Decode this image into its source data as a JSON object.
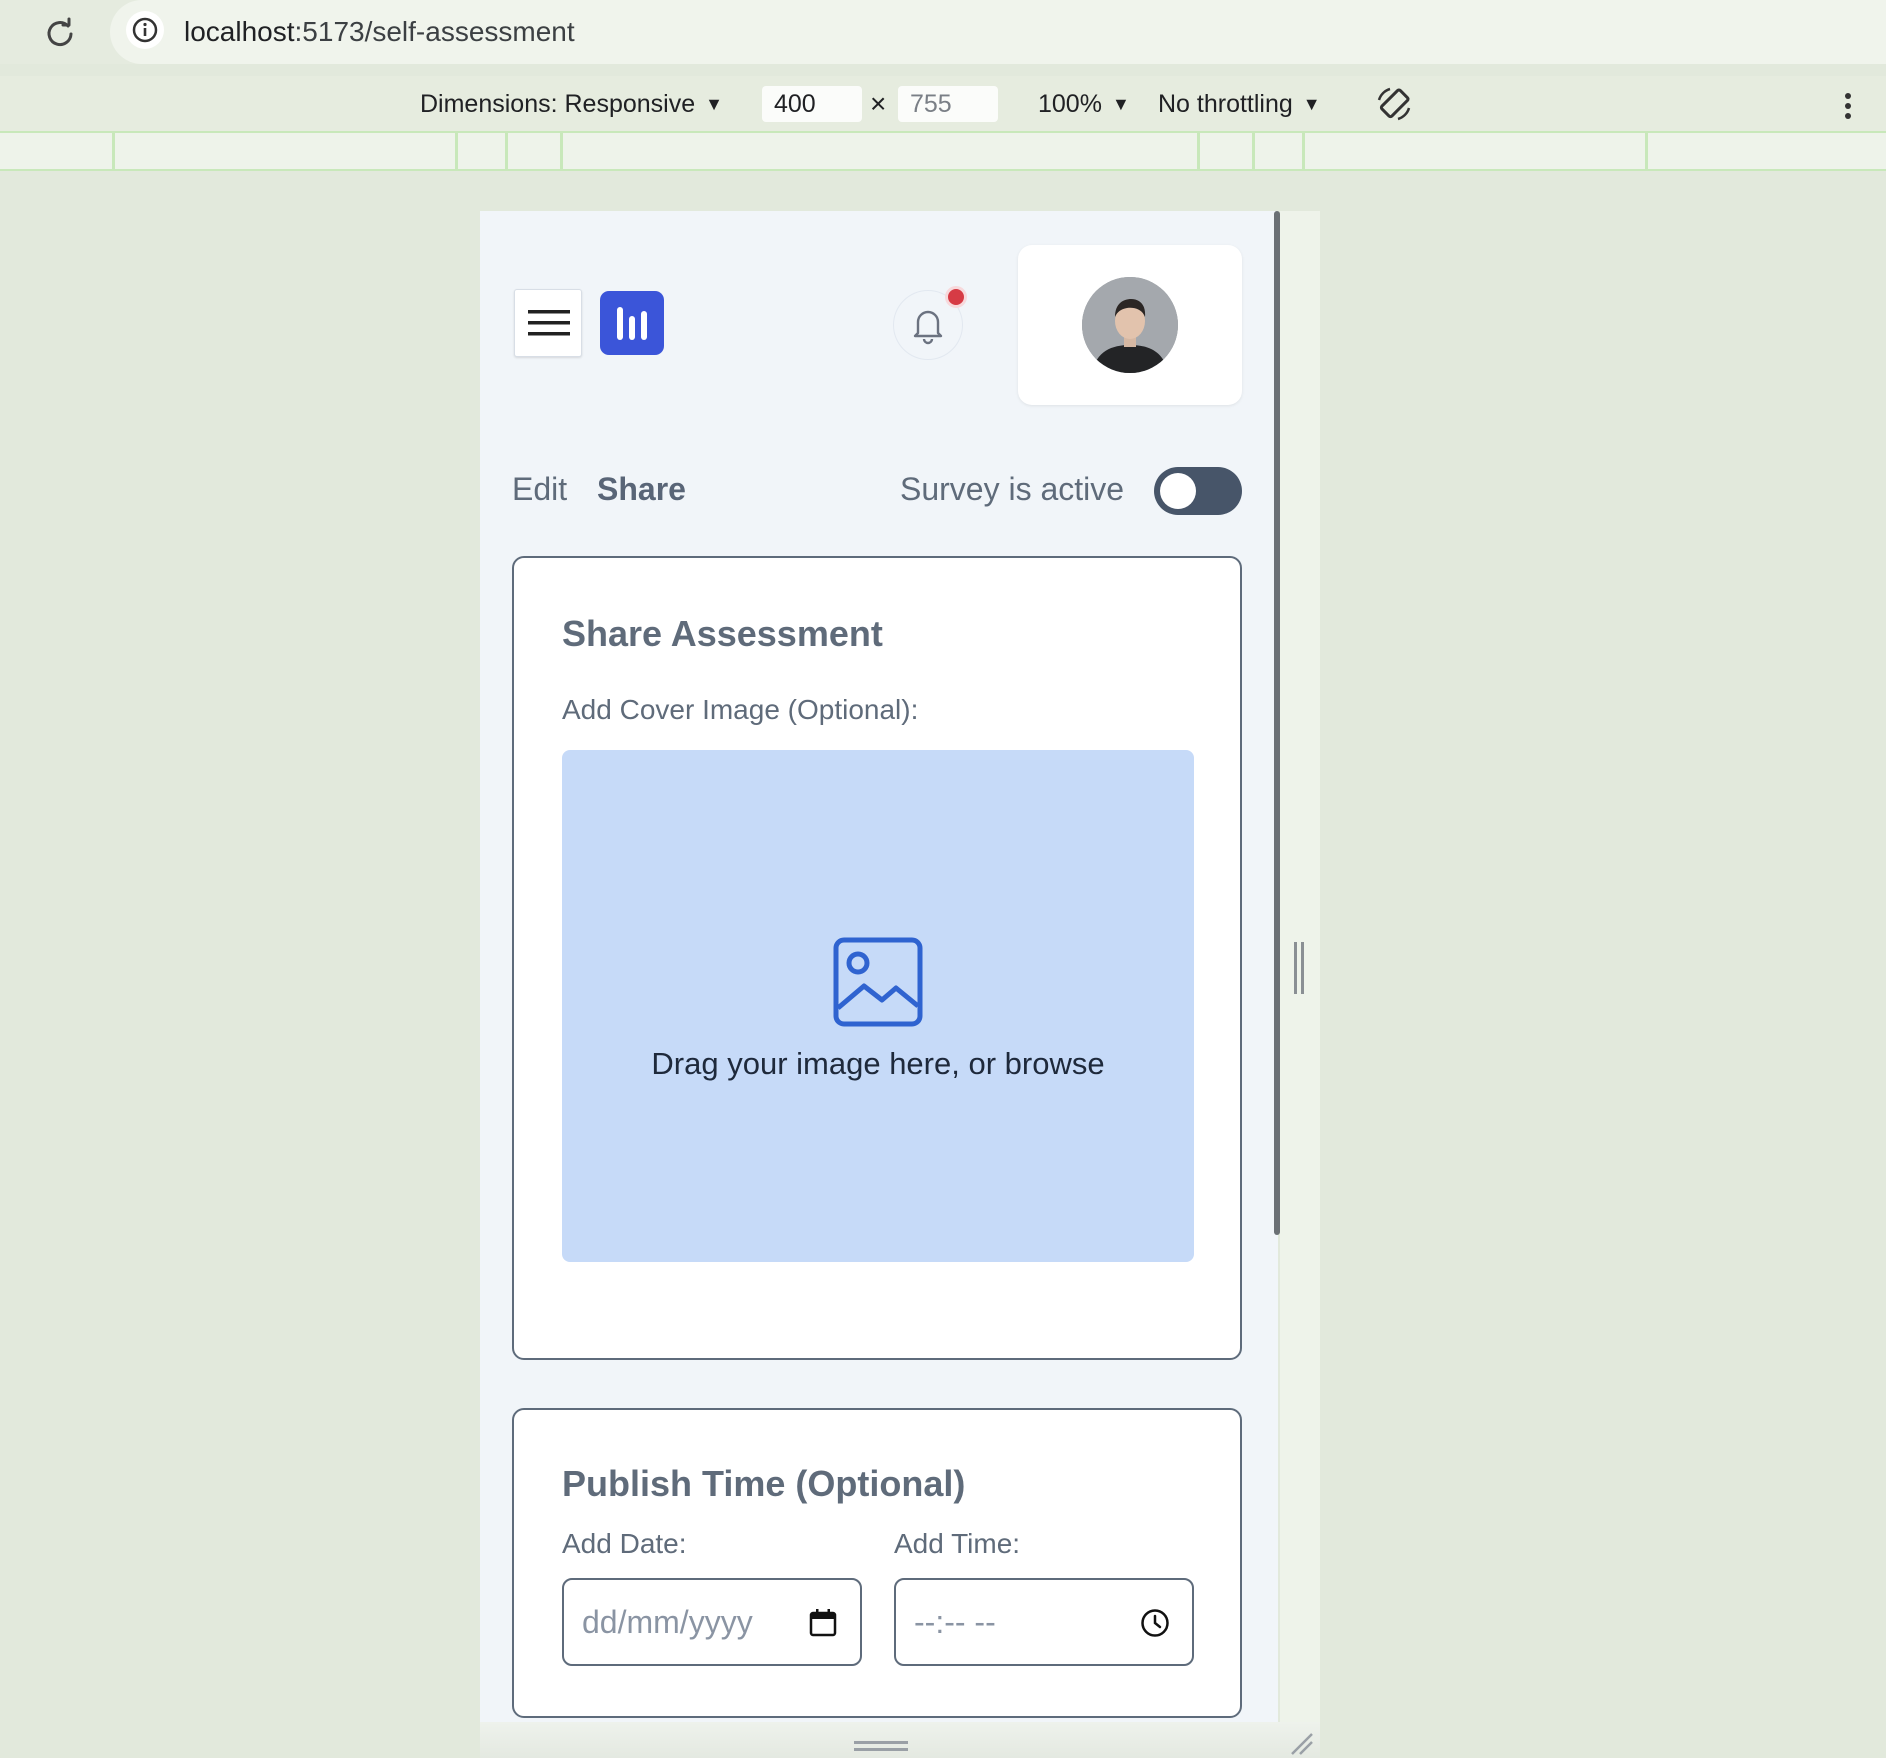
{
  "browser": {
    "url_host": "localhost",
    "url_path": ":5173/self-assessment"
  },
  "devtools": {
    "dimensions_label": "Dimensions: Responsive",
    "width_value": "400",
    "times_symbol": "×",
    "height_value": "755",
    "zoom": "100%",
    "throttling": "No throttling"
  },
  "header": {
    "notification_dot_color": "#d63b45",
    "logo_color": "#3b55d9"
  },
  "tabs": {
    "edit": "Edit",
    "share": "Share"
  },
  "survey_toggle": {
    "label": "Survey is active",
    "on": false
  },
  "share_card": {
    "title": "Share Assessment",
    "cover_label": "Add Cover Image (Optional):",
    "drop_text": "Drag your image here, or browse",
    "icon": "image-icon"
  },
  "publish_card": {
    "title": "Publish Time (Optional)",
    "date_label": "Add Date:",
    "date_placeholder": "dd/mm/yyyy",
    "time_label": "Add Time:",
    "time_placeholder": "--:-- --"
  }
}
